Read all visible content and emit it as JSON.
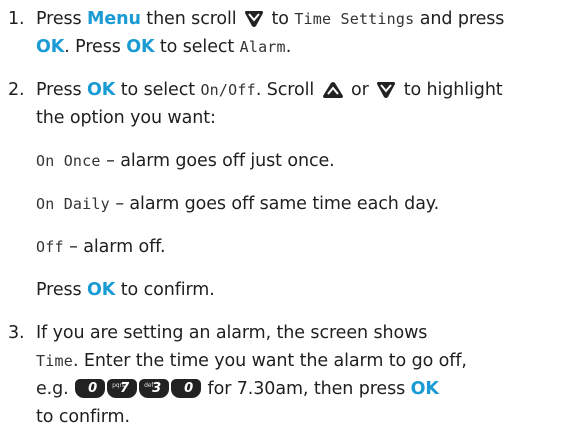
{
  "steps": [
    {
      "number": "1.",
      "line1": {
        "t1": "Press ",
        "k1": "Menu",
        "t2": " then scroll ",
        "t3": " to ",
        "lcd1": "Time Settings",
        "t4": " and press"
      },
      "line2": {
        "k1": "OK",
        "t1": ". Press ",
        "k2": "OK",
        "t2": " to select ",
        "lcd1": "Alarm",
        "t3": "."
      }
    },
    {
      "number": "2.",
      "line1": {
        "t1": "Press ",
        "k1": "OK",
        "t2": " to select ",
        "lcd1": "On/Off",
        "t3": ". Scroll ",
        "t4": " or ",
        "t5": " to highlight"
      },
      "line2": {
        "t1": "the option you want:"
      },
      "options": [
        {
          "lcd": "On Once",
          "text": " – alarm goes off just once."
        },
        {
          "lcd": "On Daily",
          "text": " – alarm goes off same time each day."
        },
        {
          "lcd": "Off",
          "text": " – alarm off."
        }
      ],
      "confirm": {
        "t1": "Press ",
        "k1": "OK",
        "t2": " to confirm."
      }
    },
    {
      "number": "3.",
      "line1": {
        "t1": "If you are setting an alarm, the screen shows"
      },
      "line2": {
        "lcd1": "Time",
        "t1": ". Enter the time you want the alarm to go off,"
      },
      "line3": {
        "t1": "e.g. ",
        "keys": [
          {
            "big": "0",
            "small": ""
          },
          {
            "big": "7",
            "small": "pqrs"
          },
          {
            "big": "3",
            "small": "def"
          },
          {
            "big": "0",
            "small": ""
          }
        ],
        "t2": " for 7.30am, then press ",
        "k1": "OK"
      },
      "line4": {
        "t1": "to confirm."
      }
    }
  ],
  "icons": {
    "scroll_down": "scroll-down-key-icon",
    "scroll_up": "scroll-up-key-icon"
  },
  "colors": {
    "key_text": "#1a9bd4",
    "body_text": "#1f1f1f",
    "key_button": "#222222"
  }
}
